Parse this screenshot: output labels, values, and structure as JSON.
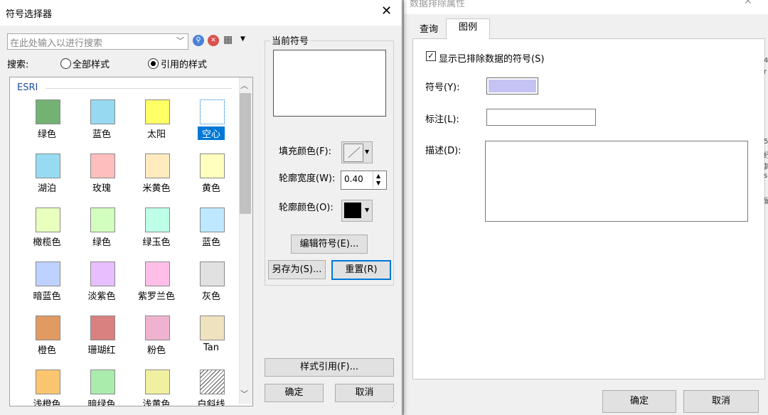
{
  "background_dialog": {
    "title": "数据排除属性",
    "close": "✕",
    "tabs": [
      "查询",
      "图例"
    ],
    "show_excluded_checkbox": {
      "label": "显示已排除数据的符号(S)",
      "checked": true
    },
    "symbol_label": "符号(Y):",
    "symbol_color": "#c5c3f4",
    "label_label": "标注(L):",
    "label_value": "",
    "description_label": "描述(D):",
    "description_value": "",
    "ok": "确定",
    "cancel": "取消",
    "edge_chars": [
      "4",
      "r",
      "5",
      "纾",
      "其",
      "sc",
      "留"
    ]
  },
  "symbol_selector": {
    "title": "符号选择器",
    "close": "✕",
    "search_placeholder": "在此处输入以进行搜索",
    "search_label": "搜索:",
    "radio_all": {
      "label": "全部样式",
      "selected": false
    },
    "radio_ref": {
      "label": "引用的样式",
      "selected": true
    },
    "group_name": "ESRI",
    "symbols": [
      {
        "name": "绿色",
        "color": "#73b273",
        "selected": false
      },
      {
        "name": "蓝色",
        "color": "#98d9f2",
        "selected": false
      },
      {
        "name": "太阳",
        "color": "#ffff66",
        "selected": false
      },
      {
        "name": "空心",
        "color": "#ffffff",
        "selected": true
      },
      {
        "name": "湖泊",
        "color": "#97dbf2",
        "selected": false
      },
      {
        "name": "玫瑰",
        "color": "#ffbebe",
        "selected": false
      },
      {
        "name": "米黄色",
        "color": "#ffebbe",
        "selected": false
      },
      {
        "name": "黄色",
        "color": "#ffffbe",
        "selected": false
      },
      {
        "name": "橄榄色",
        "color": "#e9ffbe",
        "selected": false
      },
      {
        "name": "绿色",
        "color": "#d3ffbe",
        "selected": false
      },
      {
        "name": "绿玉色",
        "color": "#beffe8",
        "selected": false
      },
      {
        "name": "蓝色",
        "color": "#bee8ff",
        "selected": false
      },
      {
        "name": "暗蓝色",
        "color": "#bed2ff",
        "selected": false
      },
      {
        "name": "淡紫色",
        "color": "#e8beff",
        "selected": false
      },
      {
        "name": "紫罗兰色",
        "color": "#ffbee8",
        "selected": false
      },
      {
        "name": "灰色",
        "color": "#e1e1e1",
        "selected": false
      },
      {
        "name": "橙色",
        "color": "#e09a62",
        "selected": false
      },
      {
        "name": "珊瑚红",
        "color": "#d98080",
        "selected": false
      },
      {
        "name": "粉色",
        "color": "#f0b3cf",
        "selected": false
      },
      {
        "name": "Tan",
        "color": "#efe3bf",
        "selected": false
      },
      {
        "name": "浅橙色",
        "color": "#fbc570",
        "selected": false
      },
      {
        "name": "暗绿色",
        "color": "#a9ecab",
        "selected": false
      },
      {
        "name": "浅黄色",
        "color": "#f0f0a0",
        "selected": false
      },
      {
        "name": "白斜线",
        "color": "#ffffff",
        "hatched": true,
        "selected": false
      }
    ],
    "current_symbol_label": "当前符号",
    "fill_color_label": "填充颜色(F):",
    "outline_width_label": "轮廓宽度(W):",
    "outline_width_value": "0.40",
    "outline_color_label": "轮廓颜色(O):",
    "outline_color": "#000000",
    "edit_symbol": "编辑符号(E)...",
    "save_as": "另存为(S)...",
    "reset": "重置(R)",
    "style_references": "样式引用(F)...",
    "ok": "确定",
    "cancel": "取消"
  }
}
